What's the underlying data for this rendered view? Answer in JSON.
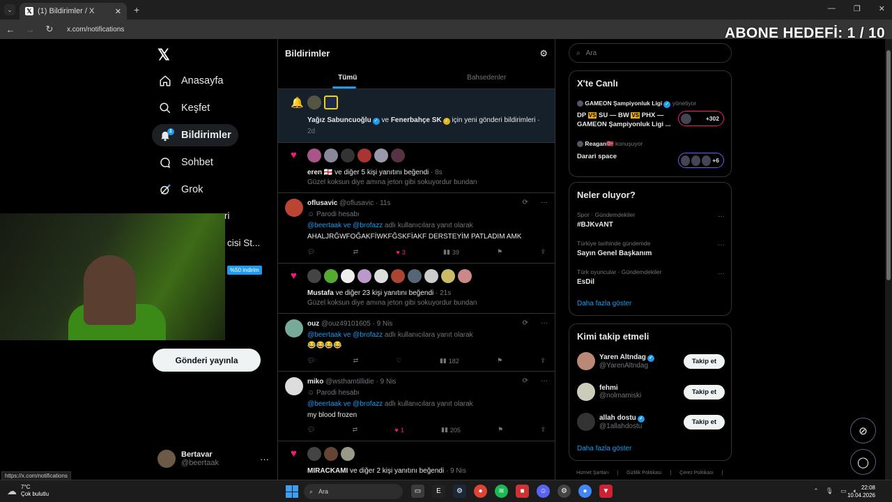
{
  "browser": {
    "tab_title": "(1) Bildirimler / X",
    "url": "x.com/notifications",
    "status_url": "https://x.com/notifications"
  },
  "overlay_title": "ABONE HEDEFİ: 1 / 10",
  "sidebar": {
    "items": [
      {
        "label": "Anasayfa",
        "icon": "home-icon"
      },
      {
        "label": "Keşfet",
        "icon": "search-icon"
      },
      {
        "label": "Bildirimler",
        "icon": "bell-icon",
        "badge": "1"
      },
      {
        "label": "Sohbet",
        "icon": "chat-icon"
      },
      {
        "label": "Grok",
        "icon": "grok-icon"
      }
    ],
    "partial_item_1": "ri",
    "partial_item_2": "cisi St...",
    "discount": "%50 indirim",
    "post_button": "Gönderi yayınla",
    "account": {
      "name": "Bertavar",
      "handle": "@beertaak"
    }
  },
  "main": {
    "title": "Bildirimler",
    "tabs": [
      "Tümü",
      "Bahsedenler"
    ],
    "n1": {
      "name1": "Yağız Sabuncuoğlu",
      "and": "ve",
      "name2": "Fenerbahçe SK",
      "rest": "için yeni gönderi bildirimleri ·",
      "time": "2d"
    },
    "n2": {
      "name": "eren 🏴󠁧󠁢󠁥󠁮󠁧󠁿",
      "rest": "ve diğer 5 kişi yanıtını beğendi",
      "time": "· 8s",
      "quote": "Güzel koksun diye amına jeton gibi sokuyordur bundan"
    },
    "t1": {
      "name": "oflusavic",
      "handle": "@oflusavic · 11s",
      "parody": "Parodi hesabı",
      "reply_users": "@beertaak ve @brofazz",
      "reply_rest": "adlı kullanıcılara yanıt olarak",
      "text": "AHALJRĞWFOĞAKFİWKFĞSKFİAKF DERSTEYİM PATLADIM AMK",
      "likes": "3",
      "views": "39"
    },
    "n3": {
      "name": "Mustafa",
      "rest": "ve diğer 23 kişi yanıtını beğendi",
      "time": "· 21s",
      "quote": "Güzel koksun diye amına jeton gibi sokuyordur bundan"
    },
    "t2": {
      "name": "ouz",
      "handle": "@ouz49101605 · 9 Nis",
      "reply_users": "@beertaak ve @brofazz",
      "reply_rest": "adlı kullanıcılara yanıt olarak",
      "text": "😂😂😂😂",
      "views": "182"
    },
    "t3": {
      "name": "miko",
      "handle": "@wsthamtillidie · 9 Nis",
      "parody": "Parodi hesabı",
      "reply_users": "@beertaak ve @brofazz",
      "reply_rest": "adlı kullanıcılara yanıt olarak",
      "text": "my blood frozen",
      "likes": "1",
      "views": "205"
    },
    "n4": {
      "name": "MIRACKAMI",
      "rest": "ve diğer 2 kişi yanıtını beğendi",
      "time": "· 9 Nis"
    }
  },
  "right": {
    "search_placeholder": "Ara",
    "live": {
      "title": "X'te Canlı",
      "s1_host": "GAMEON Şampiyonluk Ligi",
      "s1_role": "yönetiyor",
      "s1_title_a": "DP",
      "s1_title_b": "SU — BW",
      "s1_title_c": "PHX —",
      "s1_title_d": "GAMEON Şampiyonluk Ligi ...",
      "vs": "VS",
      "s1_count": "+302",
      "s2_host": "Reagan🇳🇴",
      "s2_role": "konuşuyor",
      "s2_title": "Darari space",
      "s2_count": "+6"
    },
    "trends": {
      "title": "Neler oluyor?",
      "items": [
        {
          "cat": "Spor · Gündemdekiler",
          "name": "#BJKvANT"
        },
        {
          "cat": "Türkiye tarihinde gündemde",
          "name": "Sayın Genel Başkanım"
        },
        {
          "cat": "Türk oyuncular · Gündemdekiler",
          "name": "EsDil"
        }
      ],
      "more": "Daha fazla göster"
    },
    "who": {
      "title": "Kimi takip etmeli",
      "items": [
        {
          "name": "Yaren Altndag",
          "handle": "@YarenAltndag"
        },
        {
          "name": "fehmi",
          "handle": "@nolmamiski"
        },
        {
          "name": "allah dostu",
          "handle": "@1allahdostu"
        }
      ],
      "follow": "Takip et",
      "more": "Daha fazla göster"
    },
    "footer": [
      "Hizmet Şartları",
      "|",
      "Gizlilik Politikası",
      "|",
      "Çerez Politikası",
      "|"
    ]
  },
  "taskbar": {
    "temp": "7°C",
    "weather": "Çok bulutlu",
    "search": "Ara",
    "time": "22:08",
    "date": "10.04.2026"
  }
}
